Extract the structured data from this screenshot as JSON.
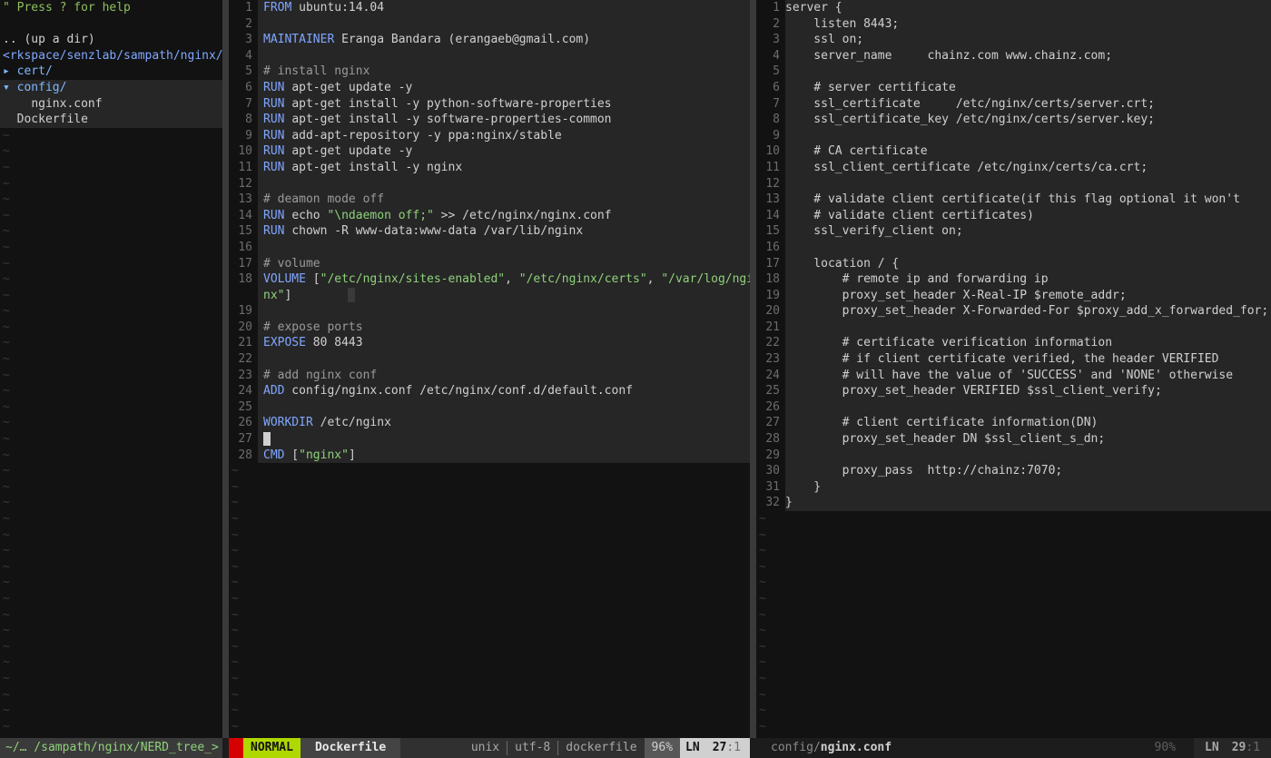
{
  "nerdtree": {
    "help": "\" Press ? for help",
    "up_dir": ".. (up a dir)",
    "cwd": "<rkspace/senzlab/sampath/nginx/",
    "items": [
      {
        "prefix": "▸ ",
        "name": "cert/",
        "kind": "dir"
      },
      {
        "prefix": "▾ ",
        "name": "config/",
        "kind": "dir"
      },
      {
        "prefix": "    ",
        "name": "nginx.conf",
        "kind": "file"
      },
      {
        "prefix": "  ",
        "name": "Dockerfile",
        "kind": "file"
      }
    ],
    "status": "~/… /sampath/nginx/NERD_tree_>"
  },
  "editor_left": {
    "lines": [
      {
        "n": "1",
        "t": [
          [
            "kw",
            "FROM"
          ],
          [
            "",
            "ubuntu:14.04"
          ]
        ]
      },
      {
        "n": "2",
        "t": []
      },
      {
        "n": "3",
        "t": [
          [
            "kw",
            "MAINTAINER"
          ],
          [
            "",
            "Eranga Bandara (erangaeb@gmail.com)"
          ]
        ]
      },
      {
        "n": "4",
        "t": []
      },
      {
        "n": "5",
        "t": [
          [
            "cmt",
            "# install nginx"
          ]
        ]
      },
      {
        "n": "6",
        "t": [
          [
            "kw",
            "RUN"
          ],
          [
            "",
            "apt-get update -y"
          ]
        ]
      },
      {
        "n": "7",
        "t": [
          [
            "kw",
            "RUN"
          ],
          [
            "",
            "apt-get install -y python-software-properties"
          ]
        ]
      },
      {
        "n": "8",
        "t": [
          [
            "kw",
            "RUN"
          ],
          [
            "",
            "apt-get install -y software-properties-common"
          ]
        ]
      },
      {
        "n": "9",
        "t": [
          [
            "kw",
            "RUN"
          ],
          [
            "",
            "add-apt-repository -y ppa:nginx/stable"
          ]
        ]
      },
      {
        "n": "10",
        "t": [
          [
            "kw",
            "RUN"
          ],
          [
            "",
            "apt-get update -y"
          ]
        ]
      },
      {
        "n": "11",
        "t": [
          [
            "kw",
            "RUN"
          ],
          [
            "",
            "apt-get install -y nginx"
          ]
        ]
      },
      {
        "n": "12",
        "t": []
      },
      {
        "n": "13",
        "t": [
          [
            "cmt",
            "# deamon mode off"
          ]
        ]
      },
      {
        "n": "14",
        "t": [
          [
            "kw",
            "RUN"
          ],
          [
            "",
            "echo "
          ],
          [
            "str",
            "\"\\ndaemon off;\""
          ],
          [
            "",
            " >> /etc/nginx/nginx.conf"
          ]
        ]
      },
      {
        "n": "15",
        "t": [
          [
            "kw",
            "RUN"
          ],
          [
            "",
            "chown -R www-data:www-data /var/lib/nginx"
          ]
        ]
      },
      {
        "n": "16",
        "t": []
      },
      {
        "n": "17",
        "t": [
          [
            "cmt",
            "# volume"
          ]
        ]
      },
      {
        "n": "18",
        "t": [
          [
            "kw",
            "VOLUME"
          ],
          [
            "",
            " ["
          ],
          [
            "str",
            "\"/etc/nginx/sites-enabled\""
          ],
          [
            "",
            ", "
          ],
          [
            "str",
            "\"/etc/nginx/certs\""
          ],
          [
            "",
            ", "
          ],
          [
            "str",
            "\"/var/log/ngi"
          ]
        ]
      },
      {
        "n": "",
        "t": [
          [
            "str",
            "nx\""
          ],
          [
            "",
            "]"
          ]
        ],
        "ghost": true
      },
      {
        "n": "19",
        "t": []
      },
      {
        "n": "20",
        "t": [
          [
            "cmt",
            "# expose ports"
          ]
        ]
      },
      {
        "n": "21",
        "t": [
          [
            "kw",
            "EXPOSE"
          ],
          [
            "",
            " 80 8443"
          ]
        ]
      },
      {
        "n": "22",
        "t": []
      },
      {
        "n": "23",
        "t": [
          [
            "cmt",
            "# add nginx conf"
          ]
        ]
      },
      {
        "n": "24",
        "t": [
          [
            "kw",
            "ADD"
          ],
          [
            "",
            " config/nginx.conf /etc/nginx/conf.d/default.conf"
          ]
        ]
      },
      {
        "n": "25",
        "t": []
      },
      {
        "n": "26",
        "t": [
          [
            "kw",
            "WORKDIR"
          ],
          [
            "",
            " /etc/nginx"
          ]
        ]
      },
      {
        "n": "27",
        "t": [
          [
            "cursor",
            " "
          ]
        ]
      },
      {
        "n": "28",
        "t": [
          [
            "kw",
            "CMD"
          ],
          [
            "",
            " ["
          ],
          [
            "str",
            "\"nginx\""
          ],
          [
            "",
            "]"
          ]
        ]
      }
    ],
    "status": {
      "mode": "NORMAL",
      "file": "Dockerfile",
      "format": "unix",
      "encoding": "utf-8",
      "filetype": "dockerfile",
      "percent": "96%",
      "ln_label": "LN",
      "line": "27",
      "col": ":1"
    }
  },
  "editor_right": {
    "lines": [
      {
        "n": "1",
        "t": "server {"
      },
      {
        "n": "2",
        "t": "    listen 8443;"
      },
      {
        "n": "3",
        "t": "    ssl on;"
      },
      {
        "n": "4",
        "t": "    server_name     chainz.com www.chainz.com;"
      },
      {
        "n": "5",
        "t": ""
      },
      {
        "n": "6",
        "t": "    # server certificate"
      },
      {
        "n": "7",
        "t": "    ssl_certificate     /etc/nginx/certs/server.crt;"
      },
      {
        "n": "8",
        "t": "    ssl_certificate_key /etc/nginx/certs/server.key;"
      },
      {
        "n": "9",
        "t": ""
      },
      {
        "n": "10",
        "t": "    # CA certificate"
      },
      {
        "n": "11",
        "t": "    ssl_client_certificate /etc/nginx/certs/ca.crt;"
      },
      {
        "n": "12",
        "t": ""
      },
      {
        "n": "13",
        "t": "    # validate client certificate(if this flag optional it won't"
      },
      {
        "n": "14",
        "t": "    # validate client certificates)"
      },
      {
        "n": "15",
        "t": "    ssl_verify_client on;"
      },
      {
        "n": "16",
        "t": ""
      },
      {
        "n": "17",
        "t": "    location / {"
      },
      {
        "n": "18",
        "t": "        # remote ip and forwarding ip"
      },
      {
        "n": "19",
        "t": "        proxy_set_header X-Real-IP $remote_addr;"
      },
      {
        "n": "20",
        "t": "        proxy_set_header X-Forwarded-For $proxy_add_x_forwarded_for;"
      },
      {
        "n": "21",
        "t": ""
      },
      {
        "n": "22",
        "t": "        # certificate verification information"
      },
      {
        "n": "23",
        "t": "        # if client certificate verified, the header VERIFIED"
      },
      {
        "n": "24",
        "t": "        # will have the value of 'SUCCESS' and 'NONE' otherwise"
      },
      {
        "n": "25",
        "t": "        proxy_set_header VERIFIED $ssl_client_verify;"
      },
      {
        "n": "26",
        "t": ""
      },
      {
        "n": "27",
        "t": "        # client certificate information(DN)"
      },
      {
        "n": "28",
        "t": "        proxy_set_header DN $ssl_client_s_dn;"
      },
      {
        "n": "29",
        "t": ""
      },
      {
        "n": "30",
        "t": "        proxy_pass  http://chainz:7070;"
      },
      {
        "n": "31",
        "t": "    }"
      },
      {
        "n": "32",
        "t": "}"
      }
    ],
    "status": {
      "path_prefix": "config/",
      "file": "nginx.conf",
      "percent": "90%",
      "ln_label": "LN",
      "line": "29",
      "col": ":1"
    }
  },
  "tilde": "~",
  "colors": {
    "keyword": "#7fa6ff",
    "string": "#8fd17a",
    "mode_bg": "#afd700",
    "error_red": "#d70000"
  }
}
